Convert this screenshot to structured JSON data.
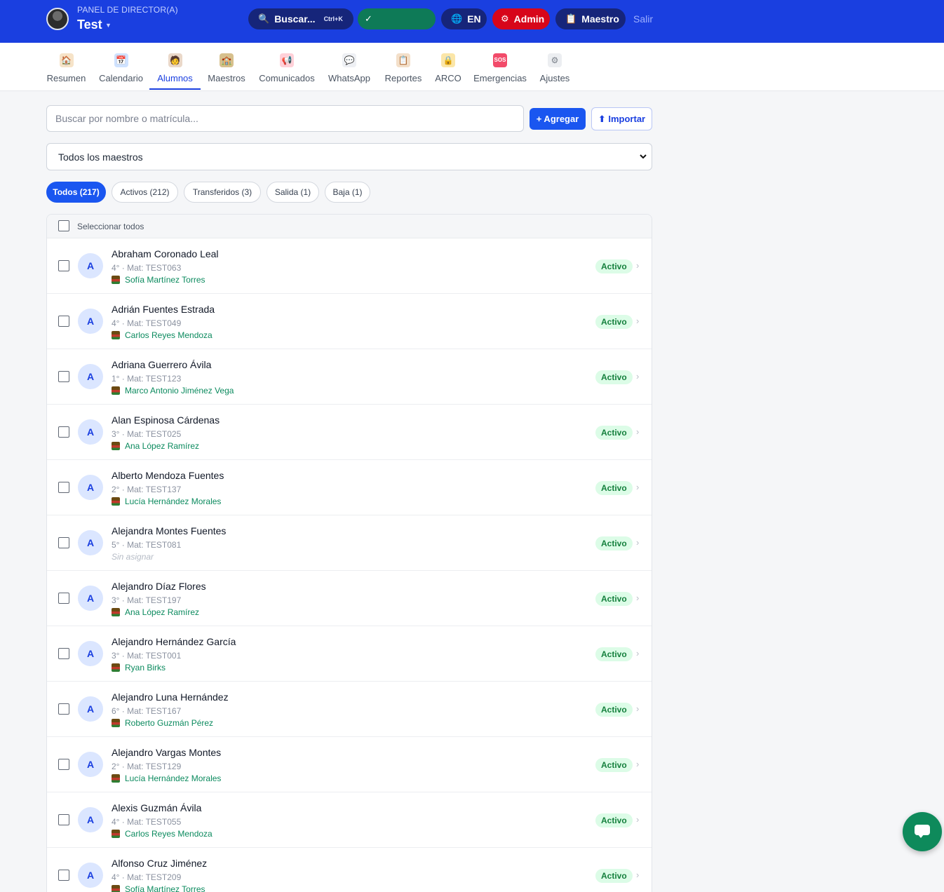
{
  "header": {
    "panel_label": "PANEL DE DIRECTOR(A)",
    "school_name": "Test",
    "search_label": "Buscar...",
    "search_shortcut": "Ctrl+K",
    "status_label": "✓",
    "lang_label": "EN",
    "admin_label": "Admin",
    "teacher_label": "Maestro",
    "logout_label": "Salir",
    "colors": {
      "bar": "#1a3fe0",
      "pill": "#16257a",
      "admin": "#d7061a",
      "status": "#0e7a57"
    }
  },
  "nav": {
    "items": [
      {
        "label": "Resumen",
        "icon": "house-icon"
      },
      {
        "label": "Calendario",
        "icon": "calendar-icon"
      },
      {
        "label": "Alumnos",
        "icon": "student-icon",
        "active": true
      },
      {
        "label": "Maestros",
        "icon": "teacher-icon"
      },
      {
        "label": "Comunicados",
        "icon": "megaphone-icon"
      },
      {
        "label": "WhatsApp",
        "icon": "chat-bubble-icon"
      },
      {
        "label": "Reportes",
        "icon": "clipboard-icon"
      },
      {
        "label": "ARCO",
        "icon": "lock-icon"
      },
      {
        "label": "Emergencias",
        "icon": "sos-icon"
      },
      {
        "label": "Ajustes",
        "icon": "gear-icon"
      }
    ]
  },
  "toolbar": {
    "search_placeholder": "Buscar por nombre o matrícula...",
    "add_label": "+ Agregar",
    "import_label": "⬆ Importar",
    "teacher_filter_value": "Todos los maestros"
  },
  "filters": [
    {
      "label": "Todos (217)",
      "active": true
    },
    {
      "label": "Activos (212)"
    },
    {
      "label": "Transferidos (3)"
    },
    {
      "label": "Salida (1)"
    },
    {
      "label": "Baja (1)"
    }
  ],
  "list": {
    "select_all_label": "Seleccionar todos",
    "status_color": "#15803d",
    "rows": [
      {
        "initial": "A",
        "name": "Abraham Coronado Leal",
        "meta": "4° · Mat: TEST063",
        "teacher": "Sofía Martínez Torres",
        "status": "Activo"
      },
      {
        "initial": "A",
        "name": "Adrián Fuentes Estrada",
        "meta": "4° · Mat: TEST049",
        "teacher": "Carlos Reyes Mendoza",
        "status": "Activo"
      },
      {
        "initial": "A",
        "name": "Adriana Guerrero Ávila",
        "meta": "1° · Mat: TEST123",
        "teacher": "Marco Antonio Jiménez Vega",
        "status": "Activo"
      },
      {
        "initial": "A",
        "name": "Alan Espinosa Cárdenas",
        "meta": "3° · Mat: TEST025",
        "teacher": "Ana López Ramírez",
        "status": "Activo"
      },
      {
        "initial": "A",
        "name": "Alberto Mendoza Fuentes",
        "meta": "2° · Mat: TEST137",
        "teacher": "Lucía Hernández Morales",
        "status": "Activo"
      },
      {
        "initial": "A",
        "name": "Alejandra Montes Fuentes",
        "meta": "5° · Mat: TEST081",
        "teacher": "Sin asignar",
        "unassigned": true,
        "status": "Activo"
      },
      {
        "initial": "A",
        "name": "Alejandro Díaz Flores",
        "meta": "3° · Mat: TEST197",
        "teacher": "Ana López Ramírez",
        "status": "Activo"
      },
      {
        "initial": "A",
        "name": "Alejandro Hernández García",
        "meta": "3° · Mat: TEST001",
        "teacher": "Ryan Birks",
        "status": "Activo"
      },
      {
        "initial": "A",
        "name": "Alejandro Luna Hernández",
        "meta": "6° · Mat: TEST167",
        "teacher": "Roberto Guzmán Pérez",
        "status": "Activo"
      },
      {
        "initial": "A",
        "name": "Alejandro Vargas Montes",
        "meta": "2° · Mat: TEST129",
        "teacher": "Lucía Hernández Morales",
        "status": "Activo"
      },
      {
        "initial": "A",
        "name": "Alexis Guzmán Ávila",
        "meta": "4° · Mat: TEST055",
        "teacher": "Carlos Reyes Mendoza",
        "status": "Activo"
      },
      {
        "initial": "A",
        "name": "Alfonso Cruz Jiménez",
        "meta": "4° · Mat: TEST209",
        "teacher": "Sofía Martínez Torres",
        "status": "Activo"
      }
    ]
  }
}
